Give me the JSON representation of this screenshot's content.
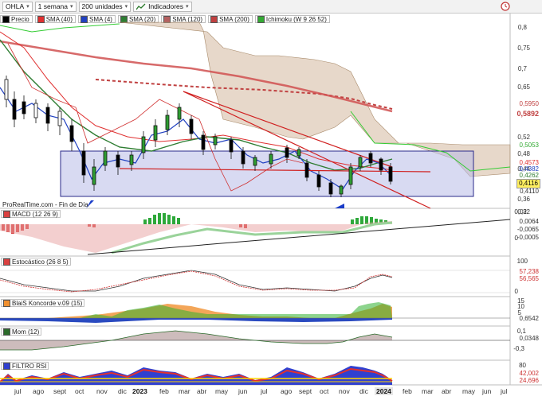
{
  "toolbar": {
    "symbol": "OHLA",
    "period": "1 semana",
    "units": "200 unidades",
    "indicators_label": "Indicadores"
  },
  "legend": {
    "items": [
      {
        "label": "Precio",
        "color": "#000000"
      },
      {
        "label": "SMA (40)",
        "color": "#e03030"
      },
      {
        "label": "SMA (4)",
        "color": "#2040c0"
      },
      {
        "label": "SMA (20)",
        "color": "#2e7d32"
      },
      {
        "label": "SMA (120)",
        "color": "#b46060"
      },
      {
        "label": "SMA (200)",
        "color": "#c04040"
      },
      {
        "label": "Ichimoku (W 9 26 52)",
        "color": "#33aa33"
      }
    ]
  },
  "attribution": "ProRealTime.com - Fin de Día",
  "price_axis": {
    "ticks": [
      "0,8",
      "0,75",
      "0,7",
      "0,65",
      "0,52",
      "0,48",
      "0,44",
      "0,36",
      "0,32"
    ],
    "tags": [
      {
        "text": "0,5950",
        "color": "#c04040",
        "bg": "#ffffff"
      },
      {
        "text": "0,5892",
        "color": "#c04040",
        "bg": "#ffffff"
      },
      {
        "text": "0,5053",
        "color": "#33aa33",
        "bg": "#ffffff"
      },
      {
        "text": "0,4573",
        "color": "#e03030",
        "bg": "#ffffff"
      },
      {
        "text": "0,4382",
        "color": "#2040c0",
        "bg": "#ffffff"
      },
      {
        "text": "0,4262",
        "color": "#2e7d32",
        "bg": "#ffffff"
      },
      {
        "text": "0,4116",
        "color": "#000000",
        "bg": "#ffef60"
      },
      {
        "text": "0,4110",
        "color": "#333333",
        "bg": "#ffffff"
      }
    ]
  },
  "panels": {
    "macd": {
      "label": "MACD (12 26 9)",
      "ticks": [
        "0,02",
        "0"
      ],
      "tags": [
        {
          "text": "0,0064",
          "color": "#333"
        },
        {
          "text": "-0,0065",
          "color": "#333"
        },
        {
          "text": "-0,0005",
          "color": "#333"
        }
      ]
    },
    "stoch": {
      "label": "Estocástico (26 8 5)",
      "ticks": [
        "100",
        "0"
      ],
      "tags": [
        {
          "text": "57,238",
          "color": "#cc3333"
        },
        {
          "text": "56,565",
          "color": "#cc3333"
        }
      ]
    },
    "koncorde": {
      "label": "BlaiS Koncorde v.09 (15)",
      "ticks": [
        "15",
        "10",
        "5",
        "0",
        "-5"
      ],
      "tags": [
        {
          "text": "0,6542",
          "color": "#333"
        }
      ]
    },
    "mom": {
      "label": "Mom (12)",
      "ticks": [
        "0,1",
        "-0,1",
        "-0,2",
        "-0,3"
      ],
      "tags": [
        {
          "text": "0,0348",
          "color": "#333"
        }
      ]
    },
    "rsi": {
      "label": "FILTRO RSI",
      "ticks": [
        "100",
        "80",
        "60",
        "40",
        "20"
      ],
      "tags": [
        {
          "text": "42,002",
          "color": "#cc3333"
        },
        {
          "text": "24,696",
          "color": "#cc3333"
        }
      ]
    }
  },
  "x_axis": {
    "labels": [
      "jul",
      "ago",
      "sept",
      "oct",
      "nov",
      "dic",
      "2023",
      "feb",
      "mar",
      "abr",
      "may",
      "jun",
      "jul",
      "ago",
      "sept",
      "oct",
      "nov",
      "dic",
      "2024",
      "feb",
      "mar",
      "abr",
      "may",
      "jun",
      "jul"
    ],
    "current": "2024"
  },
  "colors": {
    "sma40": "#e03030",
    "sma4": "#2040c0",
    "sma20": "#2e7d32",
    "sma120": "#b46060",
    "sma200": "#c04040",
    "ichimoku_cloud": "#c9a98a",
    "range_box": "#b8bce8"
  }
}
